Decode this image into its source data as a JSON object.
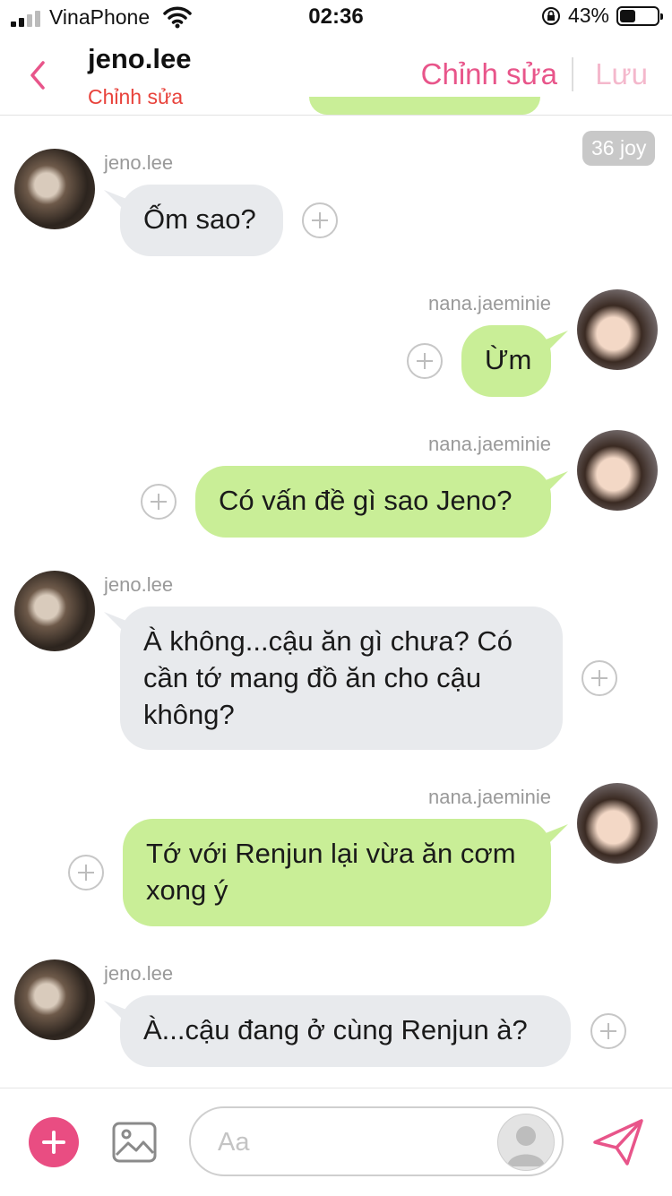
{
  "status_bar": {
    "carrier": "VinaPhone",
    "time": "02:36",
    "battery": "43%"
  },
  "header": {
    "title": "jeno.lee",
    "subtitle": "Chỉnh sửa",
    "edit_label": "Chỉnh sửa",
    "save_label": "Lưu"
  },
  "badge": "36 joy",
  "messages": [
    {
      "sender": "jeno.lee",
      "text": "Ốm sao?",
      "side": "left"
    },
    {
      "sender": "nana.jaeminie",
      "text": "Ừm",
      "side": "right"
    },
    {
      "sender": "nana.jaeminie",
      "text": "Có vấn đề gì sao Jeno?",
      "side": "right"
    },
    {
      "sender": "jeno.lee",
      "text": "À không...cậu ăn gì chưa? Có cần tớ mang đồ ăn cho cậu không?",
      "side": "left"
    },
    {
      "sender": "nana.jaeminie",
      "text": "Tớ với Renjun lại vừa ăn cơm xong ý",
      "side": "right"
    },
    {
      "sender": "jeno.lee",
      "text": "À...cậu đang ở cùng Renjun à?",
      "side": "left"
    }
  ],
  "composer": {
    "placeholder": "Aa"
  },
  "colors": {
    "accent": "#e8558a",
    "outgoing_bubble": "#c9ee97",
    "incoming_bubble": "#e8eaed",
    "subtitle": "#e8423b"
  }
}
